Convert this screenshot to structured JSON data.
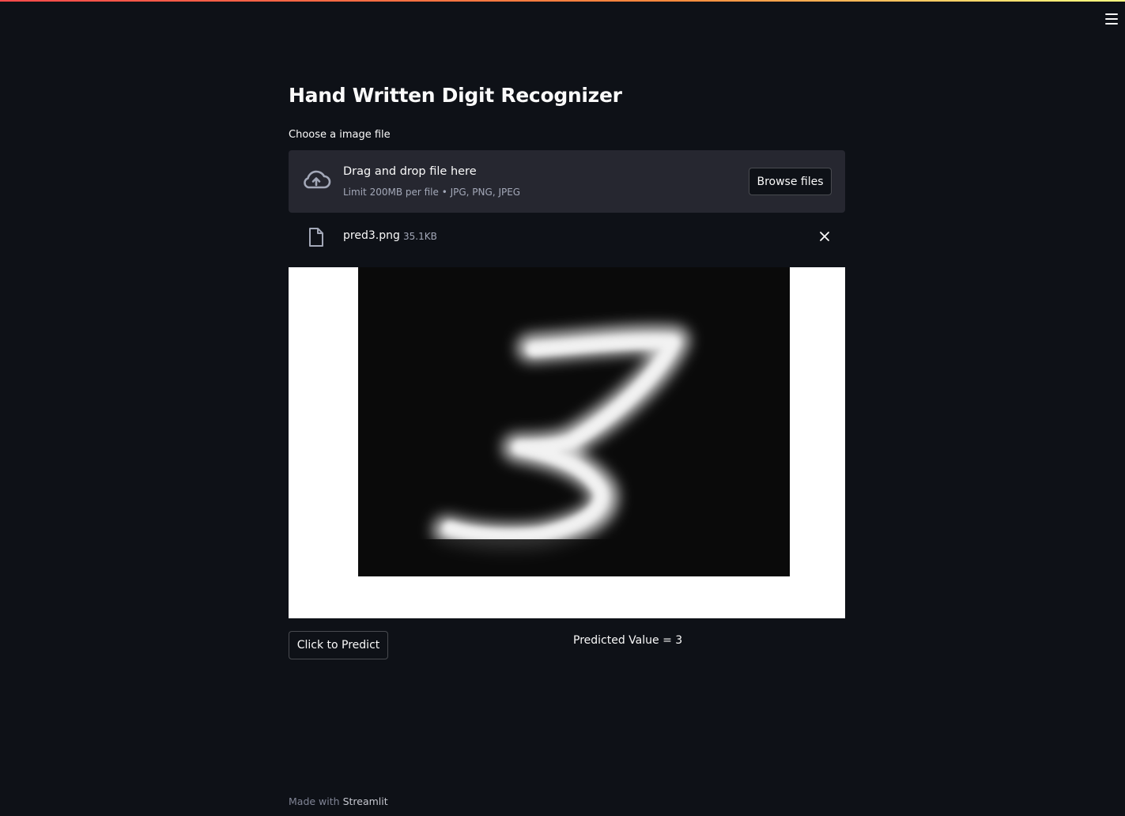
{
  "app": {
    "title": "Hand Written Digit Recognizer",
    "menu_icon": "hamburger-menu-icon"
  },
  "uploader": {
    "label": "Choose a image file",
    "drop_text": "Drag and drop file here",
    "limit_text": "Limit 200MB per file • JPG, PNG, JPEG",
    "browse_label": "Browse files",
    "icon": "cloud-upload-icon"
  },
  "uploaded_file": {
    "name": "pred3.png",
    "size": "35.1KB",
    "icon": "file-icon",
    "remove_icon": "close-icon"
  },
  "image": {
    "alt": "handwritten digit 3"
  },
  "prediction": {
    "button_label": "Click to Predict",
    "result_text": "Predicted Value = 3"
  },
  "footer": {
    "prefix": "Made with",
    "link": "Streamlit"
  },
  "colors": {
    "background": "#0e1117",
    "dropzone": "#262730",
    "accent_gradient_start": "#ff4b4b",
    "accent_gradient_end": "#fffd80"
  }
}
